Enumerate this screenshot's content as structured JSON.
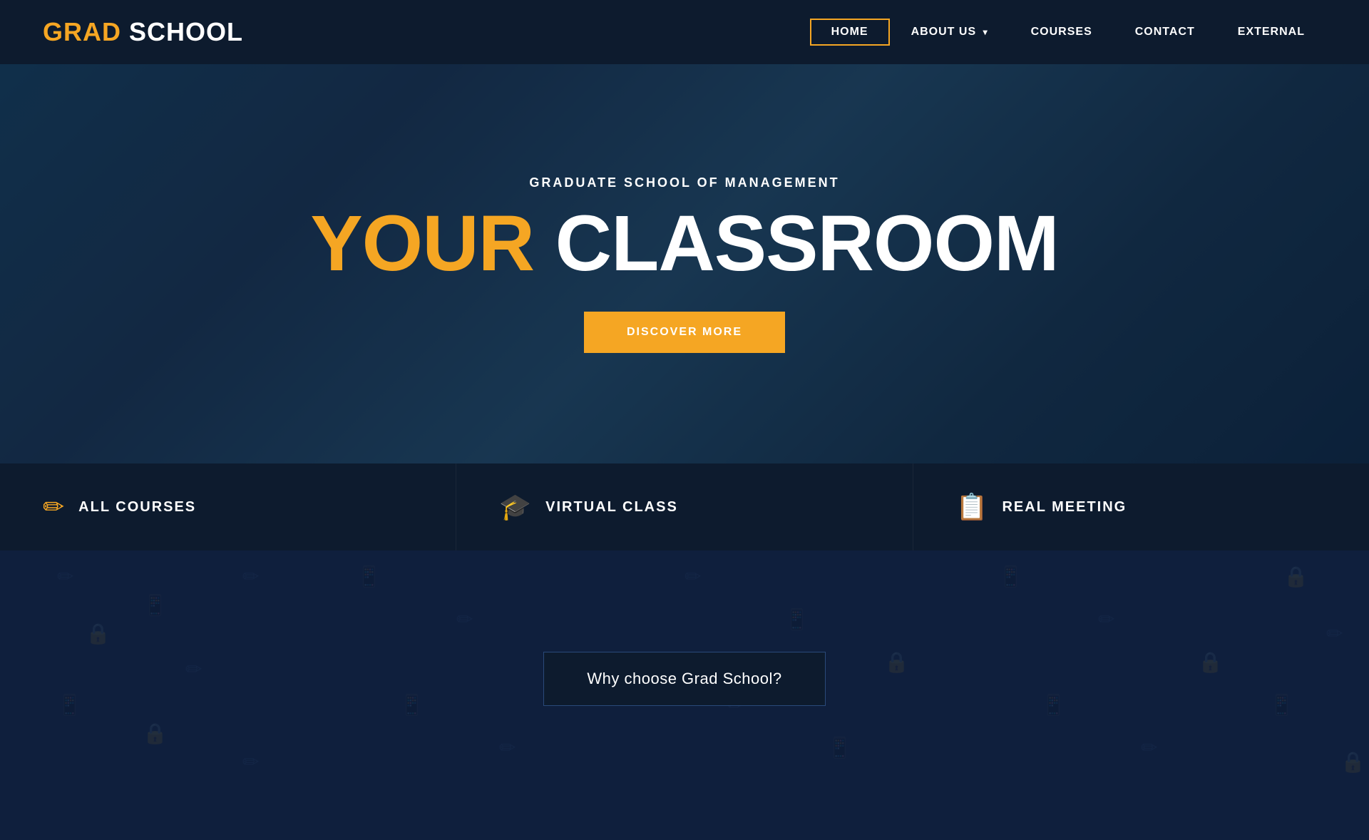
{
  "logo": {
    "grad": "GRAD",
    "school": " SCHOOL"
  },
  "nav": {
    "items": [
      {
        "label": "HOME",
        "active": true
      },
      {
        "label": "ABOUT US",
        "dropdown": true
      },
      {
        "label": "COURSES",
        "active": false
      },
      {
        "label": "CONTACT",
        "active": false
      },
      {
        "label": "EXTERNAL",
        "active": false
      }
    ]
  },
  "hero": {
    "subtitle": "GRADUATE SCHOOL OF MANAGEMENT",
    "title_your": "YOUR",
    "title_classroom": " CLASSROOM",
    "cta_button": "DISCOVER MORE"
  },
  "cards": [
    {
      "icon": "✏️",
      "label": "ALL COURSES"
    },
    {
      "icon": "🎓",
      "label": "VIRTUAL CLASS"
    },
    {
      "icon": "📋",
      "label": "REAL MEETING"
    }
  ],
  "lower": {
    "why_label": "Why choose Grad School?"
  }
}
